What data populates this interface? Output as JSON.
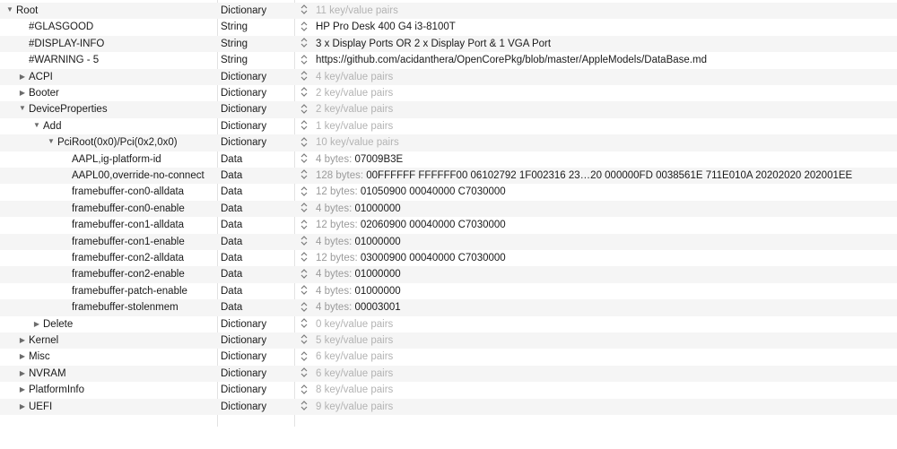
{
  "rows": [
    {
      "key": "Root",
      "type": "Dictionary",
      "value": "11 key/value pairs",
      "muted": true,
      "disclosure": "open"
    },
    {
      "key": "#GLASGOOD",
      "type": "String",
      "value": "HP Pro Desk 400 G4 i3-8100T"
    },
    {
      "key": "#DISPLAY-INFO",
      "type": "String",
      "value": "3 x Display Ports OR 2 x Display Port & 1 VGA Port"
    },
    {
      "key": "#WARNING - 5",
      "type": "String",
      "value": "https://github.com/acidanthera/OpenCorePkg/blob/master/AppleModels/DataBase.md"
    },
    {
      "key": "ACPI",
      "type": "Dictionary",
      "value": "4 key/value pairs",
      "muted": true,
      "disclosure": "closed"
    },
    {
      "key": "Booter",
      "type": "Dictionary",
      "value": "2 key/value pairs",
      "muted": true,
      "disclosure": "closed"
    },
    {
      "key": "DeviceProperties",
      "type": "Dictionary",
      "value": "2 key/value pairs",
      "muted": true,
      "disclosure": "open"
    },
    {
      "key": "Add",
      "type": "Dictionary",
      "value": "1 key/value pairs",
      "muted": true,
      "disclosure": "open"
    },
    {
      "key": "PciRoot(0x0)/Pci(0x2,0x0)",
      "type": "Dictionary",
      "value": "10 key/value pairs",
      "muted": true,
      "disclosure": "open"
    },
    {
      "key": "AAPL,ig-platform-id",
      "type": "Data",
      "prefix": "4 bytes: ",
      "value": "07009B3E"
    },
    {
      "key": "AAPL00,override-no-connect",
      "type": "Data",
      "prefix": "128 bytes: ",
      "value": "00FFFFFF FFFFFF00 06102792 1F002316 23…20 000000FD 0038561E 711E010A 20202020 202001EE"
    },
    {
      "key": "framebuffer-con0-alldata",
      "type": "Data",
      "prefix": "12 bytes: ",
      "value": "01050900 00040000 C7030000"
    },
    {
      "key": "framebuffer-con0-enable",
      "type": "Data",
      "prefix": "4 bytes: ",
      "value": "01000000"
    },
    {
      "key": "framebuffer-con1-alldata",
      "type": "Data",
      "prefix": "12 bytes: ",
      "value": "02060900 00040000 C7030000"
    },
    {
      "key": "framebuffer-con1-enable",
      "type": "Data",
      "prefix": "4 bytes: ",
      "value": "01000000"
    },
    {
      "key": "framebuffer-con2-alldata",
      "type": "Data",
      "prefix": "12 bytes: ",
      "value": "03000900 00040000 C7030000"
    },
    {
      "key": "framebuffer-con2-enable",
      "type": "Data",
      "prefix": "4 bytes: ",
      "value": "01000000"
    },
    {
      "key": "framebuffer-patch-enable",
      "type": "Data",
      "prefix": "4 bytes: ",
      "value": "01000000"
    },
    {
      "key": "framebuffer-stolenmem",
      "type": "Data",
      "prefix": "4 bytes: ",
      "value": "00003001"
    },
    {
      "key": "Delete",
      "type": "Dictionary",
      "value": "0 key/value pairs",
      "muted": true,
      "disclosure": "closed"
    },
    {
      "key": "Kernel",
      "type": "Dictionary",
      "value": "5 key/value pairs",
      "muted": true,
      "disclosure": "closed"
    },
    {
      "key": "Misc",
      "type": "Dictionary",
      "value": "6 key/value pairs",
      "muted": true,
      "disclosure": "closed"
    },
    {
      "key": "NVRAM",
      "type": "Dictionary",
      "value": "6 key/value pairs",
      "muted": true,
      "disclosure": "closed"
    },
    {
      "key": "PlatformInfo",
      "type": "Dictionary",
      "value": "8 key/value pairs",
      "muted": true,
      "disclosure": "closed"
    },
    {
      "key": "UEFI",
      "type": "Dictionary",
      "value": "9 key/value pairs",
      "muted": true,
      "disclosure": "closed"
    }
  ],
  "icons": {
    "open": "disclosure-triangle-open-icon",
    "closed": "disclosure-triangle-closed-icon",
    "stepper": "type-stepper-icon"
  },
  "colors": {
    "text": "#1a1a1a",
    "muted": "#b3b3b3",
    "row_alt": "#f5f5f5"
  }
}
